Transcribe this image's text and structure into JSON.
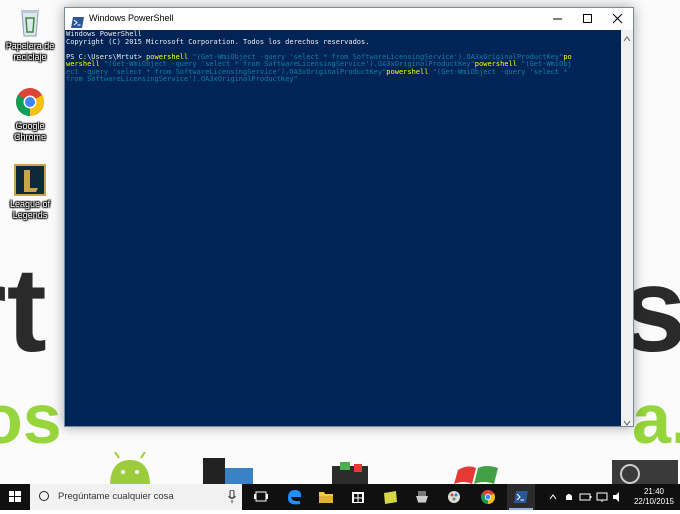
{
  "desktop": {
    "icons": [
      {
        "label": "Papelera de reciclaje",
        "icon": "recycle-bin-icon"
      },
      {
        "label": "Google Chrome",
        "icon": "chrome-icon"
      },
      {
        "label": "League of Legends",
        "icon": "league-of-legends-icon"
      }
    ]
  },
  "window": {
    "title": "Windows PowerShell",
    "controls": {
      "minimize": "minimize-icon",
      "maximize": "maximize-icon",
      "close": "close-icon"
    }
  },
  "console": {
    "line1": "Windows PowerShell",
    "line2": "Copyright (C) 2015 Microsoft Corporation. Todos los derechos reservados.",
    "prompt": "PS C:\\Users\\Mrtut> ",
    "cmd1": "powershell",
    "arg1a": " \"(Get-WmiObject -query 'select * from SoftwareLicensingService').OA3xOriginalProductKey\"",
    "cmd2a": "po",
    "cmd2b": "wershell",
    "arg2": " \"(Get-WmiObject -query 'select * from SoftwareLicensingService').OA3xOriginalProductKey\"",
    "cmd3": "powershell",
    "arg3a": " \"(Get-WmiObj",
    "arg3b": "ect -query 'select * from SoftwareLicensingService').OA3xOriginalProductKey\"",
    "cmd4": "powershell",
    "arg4a": " \"(Get-WmiObject -query 'select * ",
    "arg4b": "from SoftwareLicensingService').OA3xOriginalProductKey\""
  },
  "taskbar": {
    "search_placeholder": "Pregúntame cualquier cosa",
    "apps": [
      "task-view-icon",
      "edge-icon",
      "file-explorer-icon",
      "store-icon",
      "notes-app-icon",
      "gaming-app-icon",
      "paint-app-icon",
      "chrome-icon",
      "powershell-icon"
    ],
    "active_app": "powershell-icon",
    "time": "21:40",
    "date": "22/10/2015"
  },
  "colors": {
    "console_bg": "#012456",
    "console_text": "#eeedf0",
    "command": "#ffff00",
    "string": "#0d7fa0",
    "taskbar": "#101010"
  }
}
